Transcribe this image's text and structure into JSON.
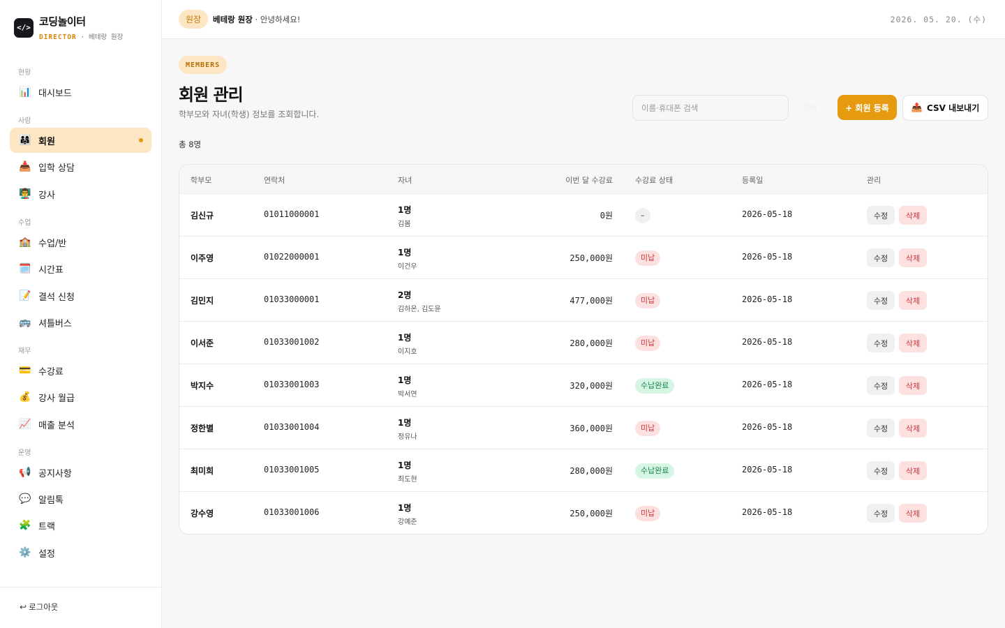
{
  "brand": {
    "logo_glyph": "</>",
    "name": "코딩놀이터",
    "role": "DIRECTOR",
    "separator": "·",
    "owner": "베테랑 원장"
  },
  "sidebar": {
    "sections": [
      "현황",
      "사람",
      "수업",
      "재무",
      "운영"
    ],
    "items": [
      {
        "icon": "📊",
        "icon_name": "bar-chart-icon",
        "label": "대시보드"
      },
      {
        "icon": "👨‍👩‍👧",
        "icon_name": "family-icon",
        "label": "회원",
        "active": true
      },
      {
        "icon": "📥",
        "icon_name": "inbox-tray-icon",
        "label": "입학 상담"
      },
      {
        "icon": "👨‍🏫",
        "icon_name": "teacher-icon",
        "label": "강사"
      },
      {
        "icon": "🏫",
        "icon_name": "school-icon",
        "label": "수업/반"
      },
      {
        "icon": "🗓️",
        "icon_name": "calendar-icon",
        "label": "시간표"
      },
      {
        "icon": "📝",
        "icon_name": "memo-icon",
        "label": "결석 신청"
      },
      {
        "icon": "🚌",
        "icon_name": "bus-icon",
        "label": "셔틀버스"
      },
      {
        "icon": "💳",
        "icon_name": "credit-card-icon",
        "label": "수강료"
      },
      {
        "icon": "💰",
        "icon_name": "money-bag-icon",
        "label": "강사 월급"
      },
      {
        "icon": "📈",
        "icon_name": "trend-chart-icon",
        "label": "매출 분석"
      },
      {
        "icon": "📢",
        "icon_name": "megaphone-icon",
        "label": "공지사항"
      },
      {
        "icon": "💬",
        "icon_name": "speech-bubble-icon",
        "label": "알림톡"
      },
      {
        "icon": "🧩",
        "icon_name": "puzzle-icon",
        "label": "트랙"
      },
      {
        "icon": "⚙️",
        "icon_name": "gear-icon",
        "label": "설정"
      }
    ],
    "logout": {
      "icon": "↩",
      "label": "로그아웃"
    }
  },
  "topbar": {
    "role_chip": "원장",
    "user_name": "베테랑 원장",
    "greeting": " · 안녕하세요!",
    "date": "2026. 05. 20. (수)"
  },
  "header": {
    "kicker": "MEMBERS",
    "title": "회원 관리",
    "description": "학부모와 자녀(학생) 정보를 조회합니다.",
    "search_placeholder": "이름·휴대폰 검색",
    "ghost_button": "검색",
    "register_button": "+ 회원 등록",
    "export_icon": "📤",
    "export_button": "CSV 내보내기",
    "total": "총 8명"
  },
  "table": {
    "headers": [
      "학부모",
      "연락처",
      "자녀",
      "이번 달 수강료",
      "수강료 상태",
      "등록일",
      "관리"
    ],
    "edit_label": "수정",
    "delete_label": "삭제",
    "rows": [
      {
        "parent": "김신규",
        "phone": "01011000001",
        "kids_count": "1명",
        "kids_names": "김봄",
        "fee": "0원",
        "status": "–",
        "status_type": "none",
        "date": "2026-05-18"
      },
      {
        "parent": "이주영",
        "phone": "01022000001",
        "kids_count": "1명",
        "kids_names": "이건우",
        "fee": "250,000원",
        "status": "미납",
        "status_type": "unpaid",
        "date": "2026-05-18"
      },
      {
        "parent": "김민지",
        "phone": "01033000001",
        "kids_count": "2명",
        "kids_names": "김하온, 김도윤",
        "fee": "477,000원",
        "status": "미납",
        "status_type": "unpaid",
        "date": "2026-05-18"
      },
      {
        "parent": "이서준",
        "phone": "01033001002",
        "kids_count": "1명",
        "kids_names": "이지호",
        "fee": "280,000원",
        "status": "미납",
        "status_type": "unpaid",
        "date": "2026-05-18"
      },
      {
        "parent": "박지수",
        "phone": "01033001003",
        "kids_count": "1명",
        "kids_names": "박서연",
        "fee": "320,000원",
        "status": "수납완료",
        "status_type": "paid",
        "date": "2026-05-18"
      },
      {
        "parent": "정한별",
        "phone": "01033001004",
        "kids_count": "1명",
        "kids_names": "정유나",
        "fee": "360,000원",
        "status": "미납",
        "status_type": "unpaid",
        "date": "2026-05-18"
      },
      {
        "parent": "최미희",
        "phone": "01033001005",
        "kids_count": "1명",
        "kids_names": "최도현",
        "fee": "280,000원",
        "status": "수납완료",
        "status_type": "paid",
        "date": "2026-05-18"
      },
      {
        "parent": "강수영",
        "phone": "01033001006",
        "kids_count": "1명",
        "kids_names": "강예준",
        "fee": "250,000원",
        "status": "미납",
        "status_type": "unpaid",
        "date": "2026-05-18"
      }
    ]
  },
  "colors": {
    "accent": "#e69a10",
    "accent_soft": "#fde6c3",
    "unpaid": "#d0363a",
    "paid": "#17854a"
  }
}
